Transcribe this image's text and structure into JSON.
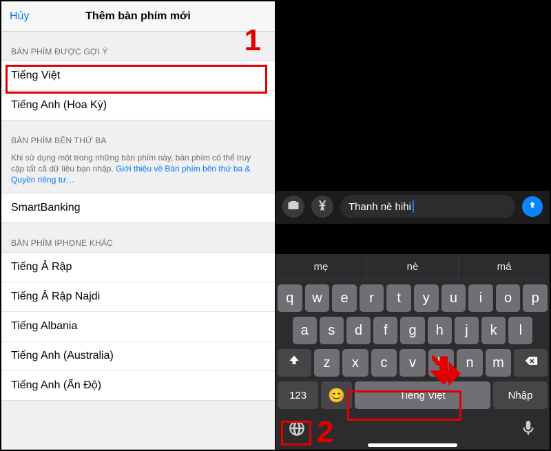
{
  "left": {
    "cancel": "Hủy",
    "title": "Thêm bàn phím mới",
    "section_suggested": "BÀN PHÍM ĐƯỢC GỢI Ý",
    "suggested": [
      "Tiếng Việt",
      "Tiếng Anh (Hoa Kỳ)"
    ],
    "section_third": "BÀN PHÍM BÊN THỨ BA",
    "third_desc_pre": "Khi sử dụng một trong những bàn phím này, bàn phím có thể truy cập tất cả dữ liệu bạn nhập. ",
    "third_desc_link": "Giới thiệu về Bàn phím bên thứ ba & Quyền riêng tư…",
    "third_party": [
      "SmartBanking"
    ],
    "section_other": "BÀN PHÍM IPHONE KHÁC",
    "other": [
      "Tiếng Ả Rập",
      "Tiếng Ả Rập Najdi",
      "Tiếng Albania",
      "Tiếng Anh (Australia)",
      "Tiếng Anh (Ấn Độ)"
    ]
  },
  "right": {
    "input_text": "Thanh nè hihi",
    "suggestions": [
      "mẹ",
      "nè",
      "má"
    ],
    "row1": [
      "q",
      "w",
      "e",
      "r",
      "t",
      "y",
      "u",
      "i",
      "o",
      "p"
    ],
    "row2": [
      "a",
      "s",
      "d",
      "f",
      "g",
      "h",
      "j",
      "k",
      "l"
    ],
    "row3": [
      "z",
      "x",
      "c",
      "v",
      "b",
      "n",
      "m"
    ],
    "num_key": "123",
    "space_label": "Tiếng Việt",
    "enter_label": "Nhập"
  },
  "annotations": {
    "one": "1",
    "two": "2"
  }
}
